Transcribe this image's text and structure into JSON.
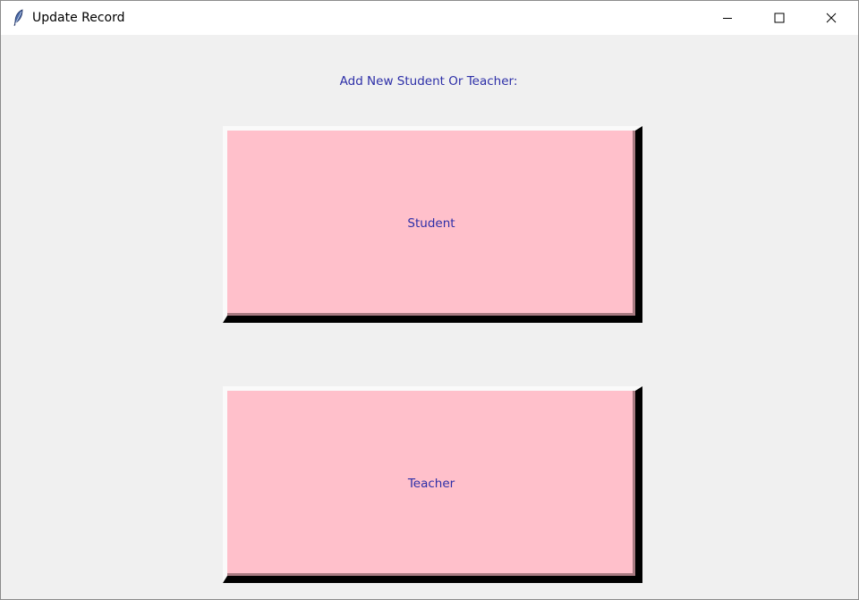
{
  "window": {
    "title": "Update Record",
    "icon": "feather-icon",
    "controls": [
      "minimize-icon",
      "maximize-icon",
      "close-icon"
    ]
  },
  "main": {
    "heading": "Add New Student Or Teacher:",
    "buttons": [
      {
        "label": "Student"
      },
      {
        "label": "Teacher"
      }
    ]
  },
  "colors": {
    "button_bg": "#ffc0cb",
    "text": "#2d2fa8",
    "window_bg": "#f0f0f0"
  }
}
